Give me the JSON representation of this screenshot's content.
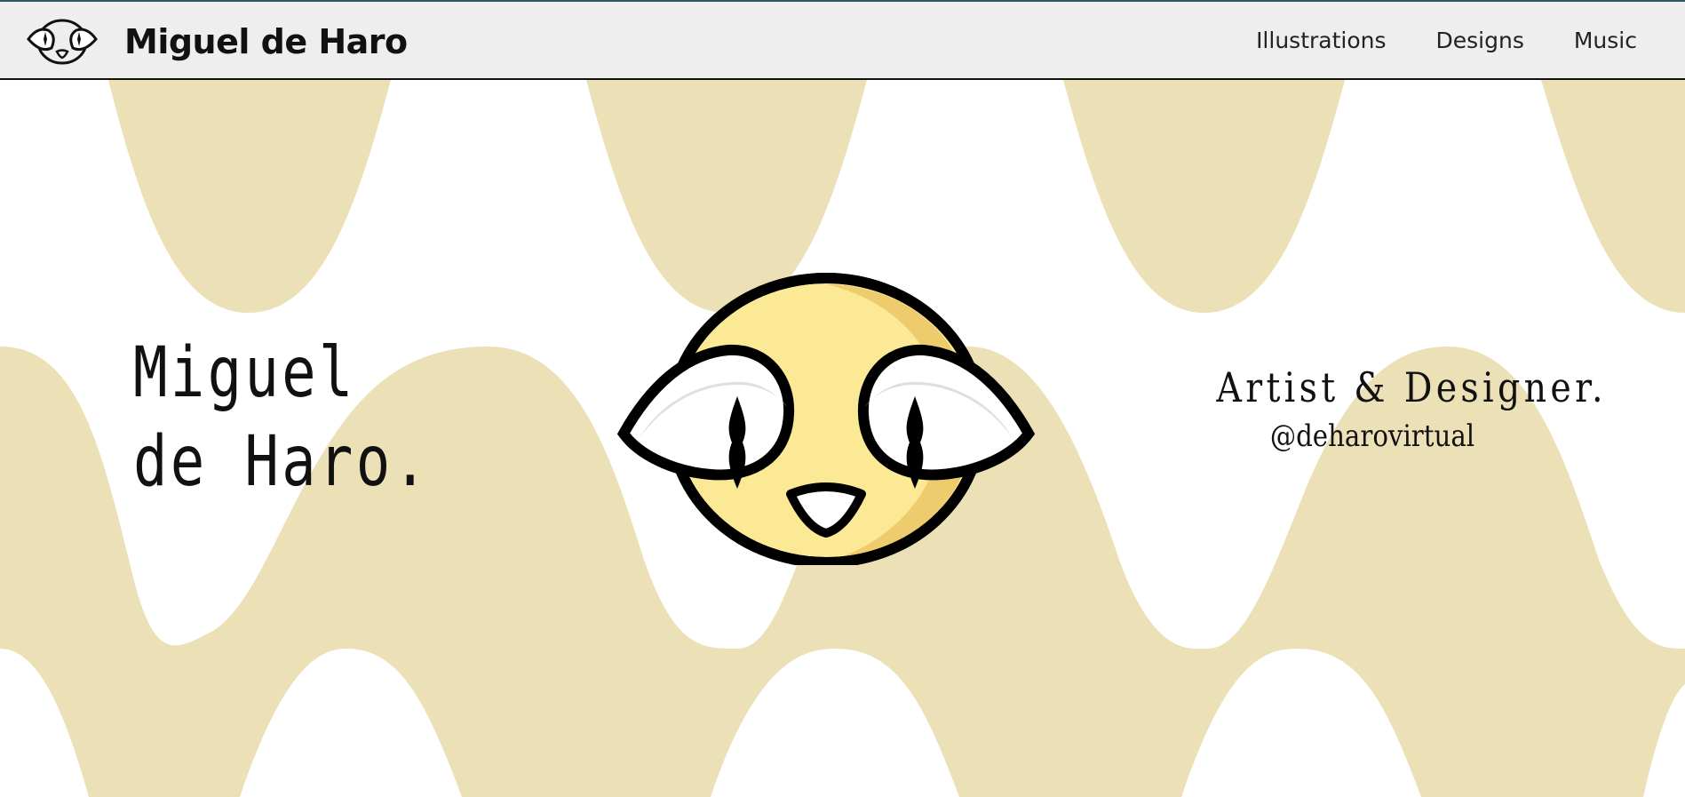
{
  "header": {
    "site_title": "Miguel de Haro",
    "logo_icon": "mascot-face-icon",
    "nav": [
      "Illustrations",
      "Designs",
      "Music"
    ]
  },
  "hero": {
    "name_line_1": "Miguel",
    "name_line_2": "de Haro.",
    "tagline": "Artist & Designer.",
    "handle": "@deharovirtual",
    "mascot_icon": "yellow-mascot-face-icon"
  },
  "colors": {
    "header_bg": "#eeeeee",
    "page_bg": "#ffffff",
    "wave": "#ece0b6",
    "mascot_yellow": "#fbe995",
    "mascot_shade": "#eecb6c",
    "eye_white": "#ffffff",
    "eye_shade": "#e2dfd8",
    "outline": "#000000"
  }
}
